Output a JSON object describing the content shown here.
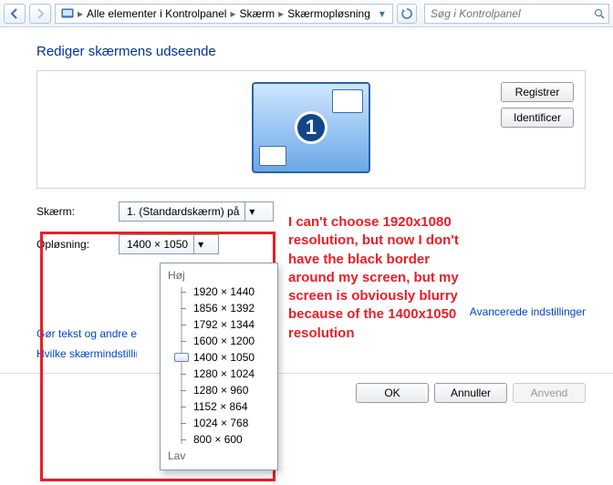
{
  "toolbar": {
    "breadcrumb": {
      "root": "Alle elementer i Kontrolpanel",
      "item1": "Skærm",
      "item2": "Skærmopløsning"
    },
    "search_placeholder": "Søg i Kontrolpanel"
  },
  "page": {
    "heading": "Rediger skærmens udseende",
    "btn_register": "Registrer",
    "btn_identify": "Identificer",
    "monitor_number": "1"
  },
  "form": {
    "screen_label": "Skærm:",
    "screen_value": "1. (Standardskærm) på",
    "resolution_label": "Opløsning:",
    "resolution_value": "1400 × 1050"
  },
  "slider": {
    "high": "Høj",
    "low": "Lav",
    "options": [
      "1920 × 1440",
      "1856 × 1392",
      "1792 × 1344",
      "1600 × 1200",
      "1400 × 1050",
      "1280 × 1024",
      "1280 × 960",
      "1152 × 864",
      "1024 × 768",
      "800 × 600"
    ],
    "selected_index": 4
  },
  "links": {
    "advanced": "Avancerede indstillinger",
    "text_items": "Gør tekst og andre elementer større eller mindre",
    "which_display": "Hvilke skærmindstillinger skal jeg vælge?"
  },
  "footer": {
    "ok": "OK",
    "cancel": "Annuller",
    "apply": "Anvend"
  },
  "annotation": {
    "text": "I can't choose 1920x1080 resolution, but now I don't have the black border around my screen, but my screen is obviously blurry because of the 1400x1050 resolution"
  }
}
